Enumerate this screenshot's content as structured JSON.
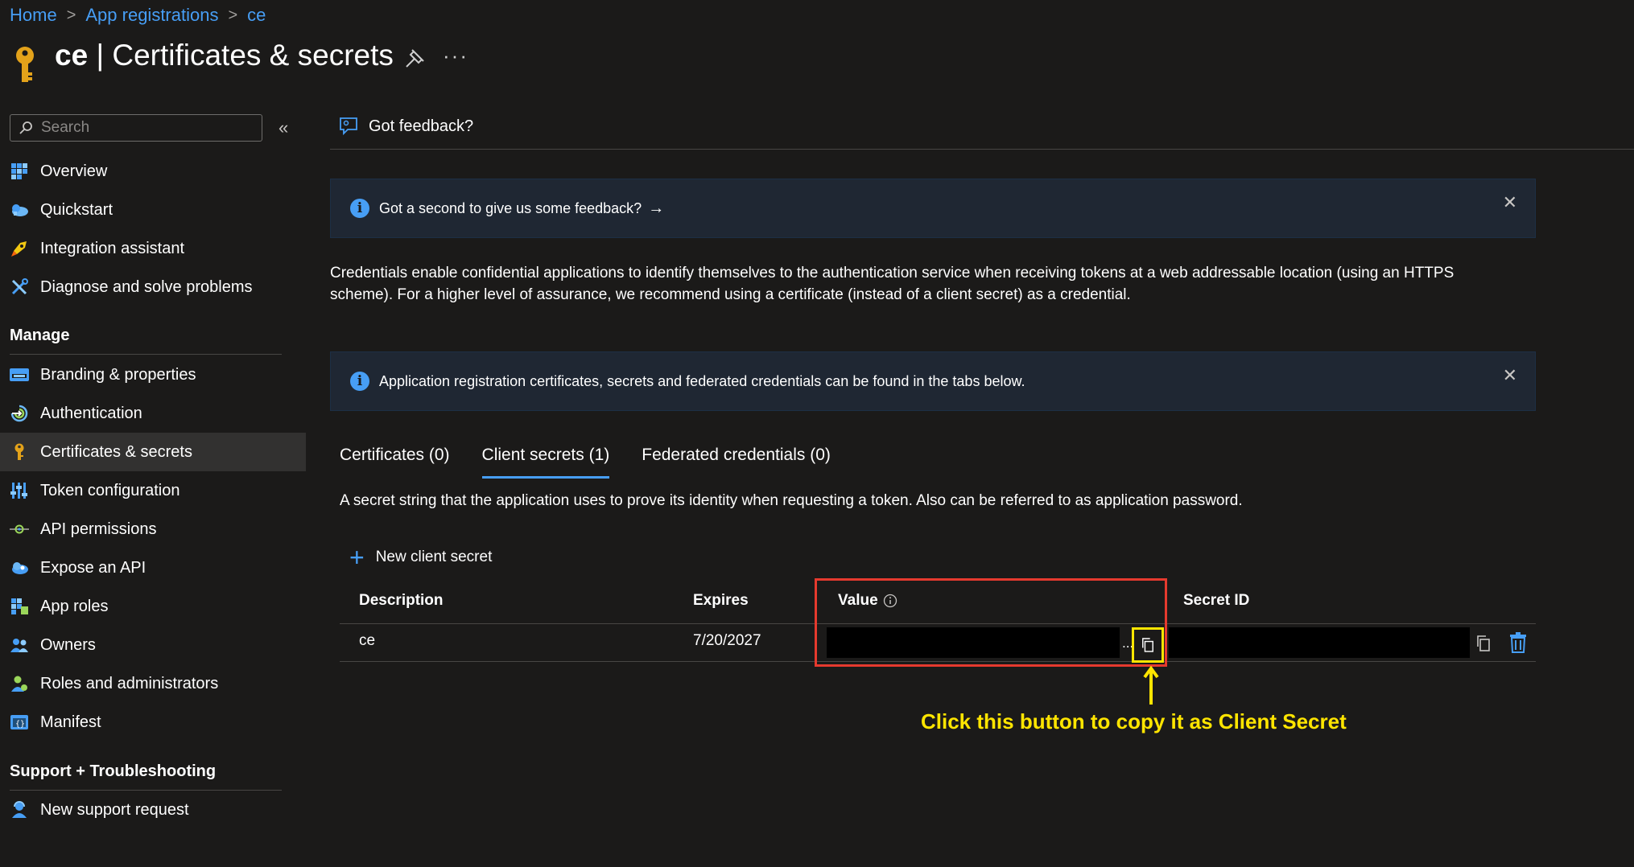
{
  "breadcrumb": {
    "home": "Home",
    "app_registrations": "App registrations",
    "app": "ce",
    "separator": ">"
  },
  "page": {
    "app_name": "ce",
    "separator": "|",
    "title": "Certificates & secrets",
    "more": "···"
  },
  "sidebar": {
    "search_placeholder": "Search",
    "collapse": "«",
    "items_top": [
      {
        "label": "Overview",
        "icon": "overview-icon"
      },
      {
        "label": "Quickstart",
        "icon": "quickstart-icon"
      },
      {
        "label": "Integration assistant",
        "icon": "rocket-icon"
      },
      {
        "label": "Diagnose and solve problems",
        "icon": "wrench-icon"
      }
    ],
    "manage_heading": "Manage",
    "items_manage": [
      {
        "label": "Branding & properties",
        "icon": "branding-icon"
      },
      {
        "label": "Authentication",
        "icon": "authentication-icon"
      },
      {
        "label": "Certificates & secrets",
        "icon": "key-icon",
        "active": true
      },
      {
        "label": "Token configuration",
        "icon": "token-icon"
      },
      {
        "label": "API permissions",
        "icon": "api-permissions-icon"
      },
      {
        "label": "Expose an API",
        "icon": "expose-api-icon"
      },
      {
        "label": "App roles",
        "icon": "app-roles-icon"
      },
      {
        "label": "Owners",
        "icon": "owners-icon"
      },
      {
        "label": "Roles and administrators",
        "icon": "roles-icon"
      },
      {
        "label": "Manifest",
        "icon": "manifest-icon"
      }
    ],
    "support_heading": "Support + Troubleshooting",
    "items_support": [
      {
        "label": "New support request",
        "icon": "support-icon"
      }
    ]
  },
  "main": {
    "feedback_label": "Got feedback?",
    "info1": {
      "text": "Got a second to give us some feedback?",
      "arrow": "→",
      "close": "✕"
    },
    "description": "Credentials enable confidential applications to identify themselves to the authentication service when receiving tokens at a web addressable location (using an HTTPS scheme). For a higher level of assurance, we recommend using a certificate (instead of a client secret) as a credential.",
    "info2": {
      "text": "Application registration certificates, secrets and federated credentials can be found in the tabs below.",
      "close": "✕"
    },
    "tabs": [
      {
        "label": "Certificates (0)"
      },
      {
        "label": "Client secrets (1)",
        "active": true
      },
      {
        "label": "Federated credentials (0)"
      }
    ],
    "tab_description": "A secret string that the application uses to prove its identity when requesting a token. Also can be referred to as application password.",
    "new_secret_label": "New client secret",
    "table": {
      "headers": {
        "description": "Description",
        "expires": "Expires",
        "value": "Value",
        "secret_id": "Secret ID"
      },
      "rows": [
        {
          "description": "ce",
          "expires": "7/20/2027",
          "value_ellipsis": "..."
        }
      ]
    },
    "callout": "Click this button to copy it as Client Secret"
  },
  "colors": {
    "accent": "#479ef5",
    "highlight_red": "#e63a2e",
    "highlight_yellow": "#ffe500",
    "background": "#1b1a19"
  }
}
